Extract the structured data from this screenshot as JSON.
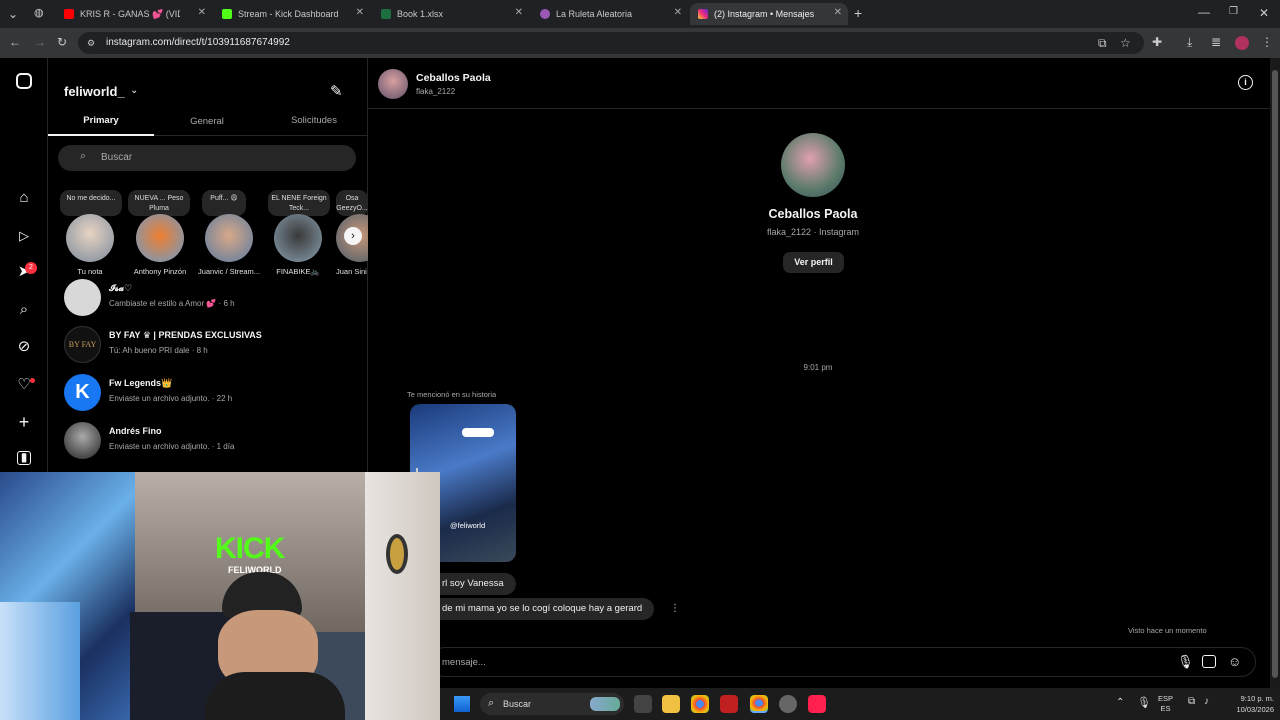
{
  "browser": {
    "tabs": [
      {
        "title": "KRIS R - GANAS 💕 (VIDEO OF",
        "icon": "youtube-icon",
        "color": "#ff0000"
      },
      {
        "title": "Stream - Kick Dashboard",
        "icon": "kick-icon",
        "color": "#53fc18"
      },
      {
        "title": "Book 1.xlsx",
        "icon": "excel-icon",
        "color": "#1d6f42"
      },
      {
        "title": "La Ruleta Aleatoria",
        "icon": "wheel-icon",
        "color": "#9b59b6"
      },
      {
        "title": "(2) Instagram • Mensajes",
        "icon": "instagram-icon",
        "color": "#e1306c"
      }
    ],
    "url": "instagram.com/direct/t/103911687674992"
  },
  "sidebar": {
    "username": "feliworld_",
    "tabs": [
      "Primary",
      "General",
      "Solicitudes"
    ],
    "search_placeholder": "Buscar",
    "notification_count": "2",
    "notes": [
      {
        "text": "No me decido..."
      },
      {
        "text": "NUEVA ... Peso Pluma"
      },
      {
        "text": "Puff... 😩"
      },
      {
        "text": "EL NENE Foreign Teck..."
      },
      {
        "text": "Osa GeezyO..."
      }
    ],
    "stories": [
      "Tu nota",
      "Anthony Pinzón",
      "Juanvic / Stream...",
      "FINABIKE🚲",
      "Juan Sini"
    ],
    "conversations": [
      {
        "name": "𝓘𝓼𝓪♡",
        "preview": "Cambiaste el estilo a Amor 💕 · 6 h",
        "color": "#d8d8d8"
      },
      {
        "name": "BY FAY ♛ | PRENDAS EXCLUSIVAS",
        "preview": "Tú: Ah bueno PRI dale · 8 h",
        "color": "#111111"
      },
      {
        "name": "Fw Legends👑",
        "preview": "Enviaste un archivo adjunto. · 22 h",
        "color": "#1877f2"
      },
      {
        "name": "Andrés Fino",
        "preview": "Enviaste un archivo adjunto. · 1 día",
        "color": "#555555"
      }
    ]
  },
  "chat": {
    "name": "Ceballos Paola",
    "handle": "flaka_2122",
    "profile_sub": "flaka_2122 · Instagram",
    "view_profile": "Ver perfil",
    "timestamp": "9:01 pm",
    "mention_label": "Te mencionó en su historia",
    "story_text": "@feliworld",
    "messages": [
      "rl soy Vanessa",
      "de mi mama yo se lo cogí coloque hay a gerard"
    ],
    "seen": "Visto hace un momento",
    "input_placeholder": "mensaje..."
  },
  "webcam": {
    "overlay_text": "KICK",
    "sub_text": "FELIWORLD"
  },
  "taskbar": {
    "search": "Buscar",
    "lang": "ESP",
    "lang2": "ES",
    "time": "9:10 p. m.",
    "date": "10/03/2026"
  }
}
